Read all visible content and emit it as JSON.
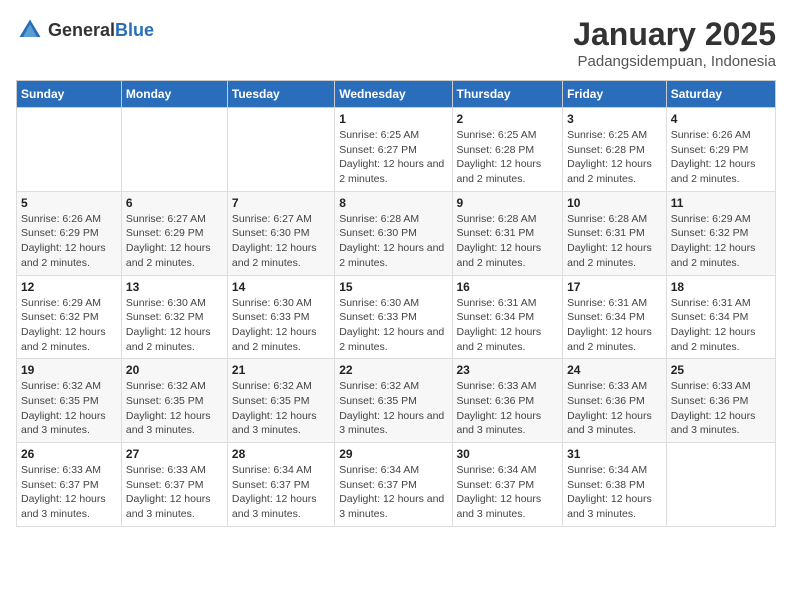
{
  "logo": {
    "general": "General",
    "blue": "Blue"
  },
  "title": "January 2025",
  "subtitle": "Padangsidempuan, Indonesia",
  "days_header": [
    "Sunday",
    "Monday",
    "Tuesday",
    "Wednesday",
    "Thursday",
    "Friday",
    "Saturday"
  ],
  "weeks": [
    [
      {
        "day": "",
        "sunrise": "",
        "sunset": "",
        "daylight": ""
      },
      {
        "day": "",
        "sunrise": "",
        "sunset": "",
        "daylight": ""
      },
      {
        "day": "",
        "sunrise": "",
        "sunset": "",
        "daylight": ""
      },
      {
        "day": "1",
        "sunrise": "Sunrise: 6:25 AM",
        "sunset": "Sunset: 6:27 PM",
        "daylight": "Daylight: 12 hours and 2 minutes."
      },
      {
        "day": "2",
        "sunrise": "Sunrise: 6:25 AM",
        "sunset": "Sunset: 6:28 PM",
        "daylight": "Daylight: 12 hours and 2 minutes."
      },
      {
        "day": "3",
        "sunrise": "Sunrise: 6:25 AM",
        "sunset": "Sunset: 6:28 PM",
        "daylight": "Daylight: 12 hours and 2 minutes."
      },
      {
        "day": "4",
        "sunrise": "Sunrise: 6:26 AM",
        "sunset": "Sunset: 6:29 PM",
        "daylight": "Daylight: 12 hours and 2 minutes."
      }
    ],
    [
      {
        "day": "5",
        "sunrise": "Sunrise: 6:26 AM",
        "sunset": "Sunset: 6:29 PM",
        "daylight": "Daylight: 12 hours and 2 minutes."
      },
      {
        "day": "6",
        "sunrise": "Sunrise: 6:27 AM",
        "sunset": "Sunset: 6:29 PM",
        "daylight": "Daylight: 12 hours and 2 minutes."
      },
      {
        "day": "7",
        "sunrise": "Sunrise: 6:27 AM",
        "sunset": "Sunset: 6:30 PM",
        "daylight": "Daylight: 12 hours and 2 minutes."
      },
      {
        "day": "8",
        "sunrise": "Sunrise: 6:28 AM",
        "sunset": "Sunset: 6:30 PM",
        "daylight": "Daylight: 12 hours and 2 minutes."
      },
      {
        "day": "9",
        "sunrise": "Sunrise: 6:28 AM",
        "sunset": "Sunset: 6:31 PM",
        "daylight": "Daylight: 12 hours and 2 minutes."
      },
      {
        "day": "10",
        "sunrise": "Sunrise: 6:28 AM",
        "sunset": "Sunset: 6:31 PM",
        "daylight": "Daylight: 12 hours and 2 minutes."
      },
      {
        "day": "11",
        "sunrise": "Sunrise: 6:29 AM",
        "sunset": "Sunset: 6:32 PM",
        "daylight": "Daylight: 12 hours and 2 minutes."
      }
    ],
    [
      {
        "day": "12",
        "sunrise": "Sunrise: 6:29 AM",
        "sunset": "Sunset: 6:32 PM",
        "daylight": "Daylight: 12 hours and 2 minutes."
      },
      {
        "day": "13",
        "sunrise": "Sunrise: 6:30 AM",
        "sunset": "Sunset: 6:32 PM",
        "daylight": "Daylight: 12 hours and 2 minutes."
      },
      {
        "day": "14",
        "sunrise": "Sunrise: 6:30 AM",
        "sunset": "Sunset: 6:33 PM",
        "daylight": "Daylight: 12 hours and 2 minutes."
      },
      {
        "day": "15",
        "sunrise": "Sunrise: 6:30 AM",
        "sunset": "Sunset: 6:33 PM",
        "daylight": "Daylight: 12 hours and 2 minutes."
      },
      {
        "day": "16",
        "sunrise": "Sunrise: 6:31 AM",
        "sunset": "Sunset: 6:34 PM",
        "daylight": "Daylight: 12 hours and 2 minutes."
      },
      {
        "day": "17",
        "sunrise": "Sunrise: 6:31 AM",
        "sunset": "Sunset: 6:34 PM",
        "daylight": "Daylight: 12 hours and 2 minutes."
      },
      {
        "day": "18",
        "sunrise": "Sunrise: 6:31 AM",
        "sunset": "Sunset: 6:34 PM",
        "daylight": "Daylight: 12 hours and 2 minutes."
      }
    ],
    [
      {
        "day": "19",
        "sunrise": "Sunrise: 6:32 AM",
        "sunset": "Sunset: 6:35 PM",
        "daylight": "Daylight: 12 hours and 3 minutes."
      },
      {
        "day": "20",
        "sunrise": "Sunrise: 6:32 AM",
        "sunset": "Sunset: 6:35 PM",
        "daylight": "Daylight: 12 hours and 3 minutes."
      },
      {
        "day": "21",
        "sunrise": "Sunrise: 6:32 AM",
        "sunset": "Sunset: 6:35 PM",
        "daylight": "Daylight: 12 hours and 3 minutes."
      },
      {
        "day": "22",
        "sunrise": "Sunrise: 6:32 AM",
        "sunset": "Sunset: 6:35 PM",
        "daylight": "Daylight: 12 hours and 3 minutes."
      },
      {
        "day": "23",
        "sunrise": "Sunrise: 6:33 AM",
        "sunset": "Sunset: 6:36 PM",
        "daylight": "Daylight: 12 hours and 3 minutes."
      },
      {
        "day": "24",
        "sunrise": "Sunrise: 6:33 AM",
        "sunset": "Sunset: 6:36 PM",
        "daylight": "Daylight: 12 hours and 3 minutes."
      },
      {
        "day": "25",
        "sunrise": "Sunrise: 6:33 AM",
        "sunset": "Sunset: 6:36 PM",
        "daylight": "Daylight: 12 hours and 3 minutes."
      }
    ],
    [
      {
        "day": "26",
        "sunrise": "Sunrise: 6:33 AM",
        "sunset": "Sunset: 6:37 PM",
        "daylight": "Daylight: 12 hours and 3 minutes."
      },
      {
        "day": "27",
        "sunrise": "Sunrise: 6:33 AM",
        "sunset": "Sunset: 6:37 PM",
        "daylight": "Daylight: 12 hours and 3 minutes."
      },
      {
        "day": "28",
        "sunrise": "Sunrise: 6:34 AM",
        "sunset": "Sunset: 6:37 PM",
        "daylight": "Daylight: 12 hours and 3 minutes."
      },
      {
        "day": "29",
        "sunrise": "Sunrise: 6:34 AM",
        "sunset": "Sunset: 6:37 PM",
        "daylight": "Daylight: 12 hours and 3 minutes."
      },
      {
        "day": "30",
        "sunrise": "Sunrise: 6:34 AM",
        "sunset": "Sunset: 6:37 PM",
        "daylight": "Daylight: 12 hours and 3 minutes."
      },
      {
        "day": "31",
        "sunrise": "Sunrise: 6:34 AM",
        "sunset": "Sunset: 6:38 PM",
        "daylight": "Daylight: 12 hours and 3 minutes."
      },
      {
        "day": "",
        "sunrise": "",
        "sunset": "",
        "daylight": ""
      }
    ]
  ]
}
